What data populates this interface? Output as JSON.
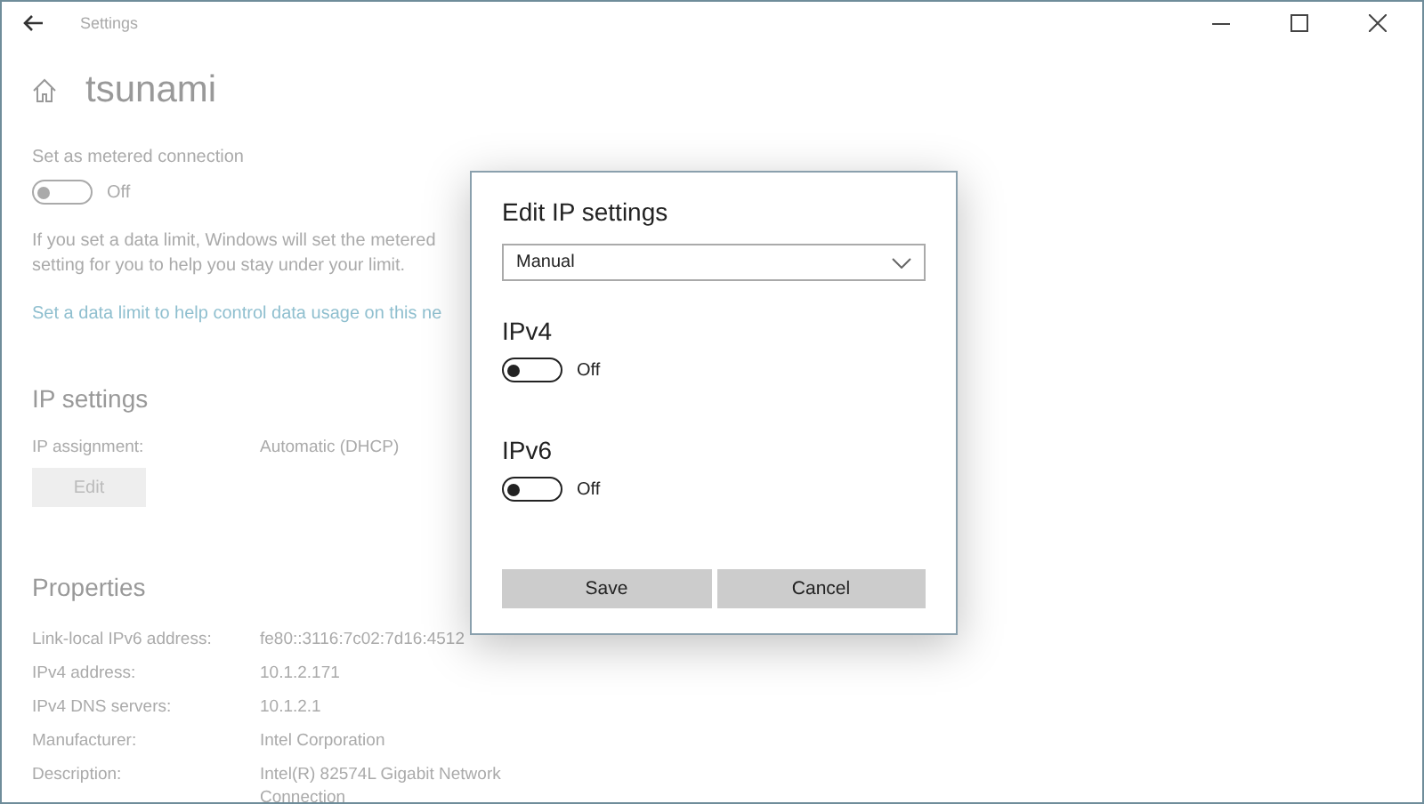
{
  "window": {
    "title": "Settings"
  },
  "page": {
    "title": "tsunami",
    "metered": {
      "label": "Set as metered connection",
      "on": false,
      "state": "Off"
    },
    "note_lines": [
      "If you set a data limit, Windows will set the metered",
      "setting for you to help you stay under your limit."
    ],
    "link": "Set a data limit to help control data usage on this ne",
    "ip_settings": {
      "heading": "IP settings",
      "label": "IP assignment:",
      "value": "Automatic (DHCP)",
      "button": "Edit"
    },
    "properties": {
      "heading": "Properties",
      "rows": [
        {
          "label": "Link-local IPv6 address:",
          "value": "fe80::3116:7c02:7d16:4512"
        },
        {
          "label": "IPv4 address:",
          "value": "10.1.2.171"
        },
        {
          "label": "IPv4 DNS servers:",
          "value": "10.1.2.1"
        },
        {
          "label": "Manufacturer:",
          "value": "Intel Corporation"
        },
        {
          "label": "Description:",
          "value": "Intel(R) 82574L Gigabit Network Connection"
        }
      ]
    }
  },
  "dialog": {
    "title": "Edit IP settings",
    "dropdown": {
      "value": "Manual"
    },
    "toggles": [
      {
        "label": "IPv4",
        "on": false,
        "state": "Off"
      },
      {
        "label": "IPv6",
        "on": false,
        "state": "Off"
      }
    ],
    "buttons": [
      "Save",
      "Cancel"
    ]
  }
}
